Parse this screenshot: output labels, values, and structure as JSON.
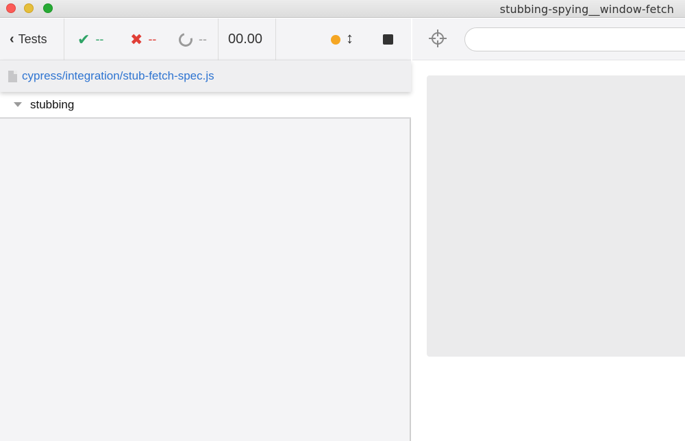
{
  "window": {
    "title": "stubbing-spying__window-fetch"
  },
  "reporter": {
    "back_label": "Tests",
    "passed": "--",
    "failed": "--",
    "pending": "--",
    "duration": "00.00",
    "status_color": "#f5a623",
    "spec_path": "cypress/integration/stub-fetch-spec.js",
    "suite_title": "stubbing"
  },
  "aut": {
    "url_value": ""
  },
  "icons": {
    "back": "chevron-left-icon",
    "passed": "checkmark-icon",
    "failed": "x-icon",
    "pending": "spinner-ring-icon",
    "scroll": "up-down-arrow-icon",
    "stop": "stop-square-icon",
    "selector": "crosshair-icon",
    "file": "file-icon",
    "caret": "caret-down-icon"
  },
  "colors": {
    "passed": "#2fa366",
    "failed": "#e03e36",
    "pending": "#9a9a9a",
    "link": "#2e74d1"
  }
}
